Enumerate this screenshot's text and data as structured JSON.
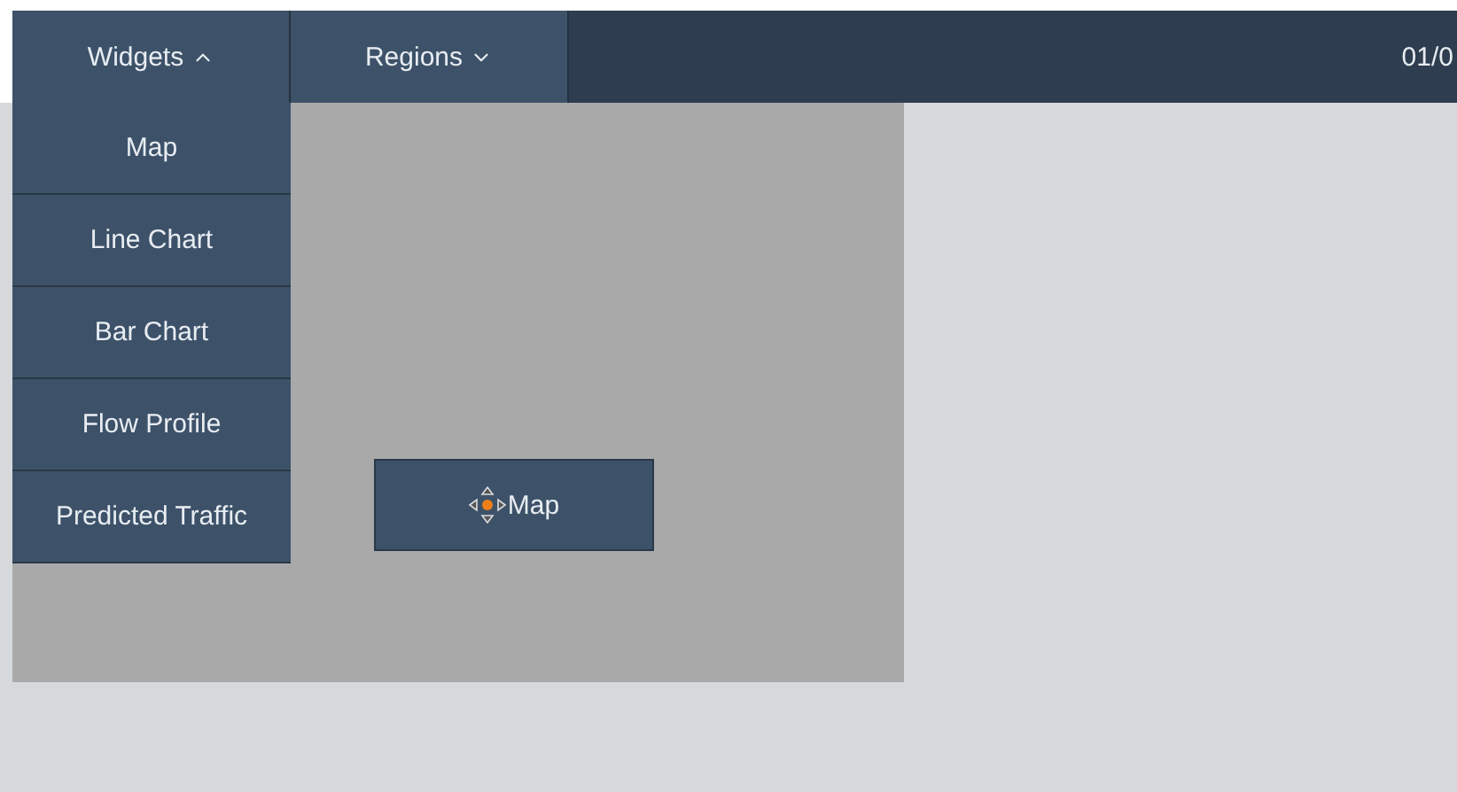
{
  "nav": {
    "menus": [
      {
        "label": "Widgets",
        "expanded": true
      },
      {
        "label": "Regions",
        "expanded": false
      }
    ],
    "date": "01/0"
  },
  "dropdown": {
    "items": [
      "Map",
      "Line Chart",
      "Bar Chart",
      "Flow Profile",
      "Predicted Traffic"
    ]
  },
  "dragged_widget": {
    "label": "Map"
  }
}
